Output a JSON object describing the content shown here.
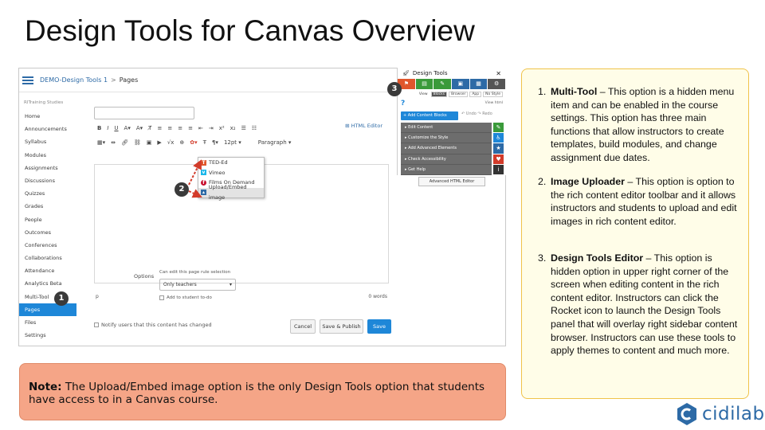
{
  "slide": {
    "title": "Design Tools for Canvas Overview"
  },
  "screenshot": {
    "breadcrumb": {
      "course": "DEMO-Design Tools 1",
      "separator": ">",
      "current": "Pages"
    },
    "course_label": "RITraining Studies",
    "nav_items": [
      "Home",
      "Announcements",
      "Syllabus",
      "Modules",
      "Assignments",
      "Discussions",
      "Quizzes",
      "Grades",
      "People",
      "Outcomes",
      "Conferences",
      "Collaborations",
      "Attendance",
      "Analytics Beta",
      "Multi-Tool",
      "Pages",
      "Files",
      "Settings"
    ],
    "active_nav": "Pages",
    "html_editor_link": "HTML Editor",
    "toolbar": {
      "font_size": "12pt",
      "paragraph": "Paragraph"
    },
    "dropdown_items": [
      "TED-Ed",
      "Vimeo",
      "Films On Demand",
      "Upload/Embed image"
    ],
    "path_label": "p",
    "word_count": "0 words",
    "options_label": "Options",
    "edit_permission_label": "Can edit this page rule selection",
    "edit_permission_value": "Only teachers",
    "add_to_todo": "Add to student to-do",
    "notify_label": "Notify users that this content has changed",
    "buttons": {
      "cancel": "Cancel",
      "save_publish": "Save & Publish",
      "save": "Save"
    },
    "badges": [
      "1",
      "2",
      "3"
    ]
  },
  "design_tools_panel": {
    "title": "Design Tools",
    "view_label": "View",
    "tabs": [
      "Blocks",
      "Browser",
      "App",
      "No Style"
    ],
    "active_tab": "Blocks",
    "view_right": "View html",
    "add_button": "+ Add Content Blocks",
    "undo": "Undo",
    "redo": "Redo",
    "menu": [
      "Edit Content",
      "Customize the Style",
      "Add Advanced Elements",
      "Check Accessibility",
      "Get Help"
    ],
    "adv_html": "Advanced HTML Editor",
    "colors": {
      "icon_bar": [
        "#e0562c",
        "#3a9a3a",
        "#3a9a3a",
        "#2d6aa6",
        "#2d6aa6",
        "#555555"
      ],
      "side": [
        "#3a9a3a",
        "#1e87d8",
        "#2d6aa6",
        "#d23b2a",
        "#333333"
      ]
    }
  },
  "note": {
    "label": "Note:",
    "text": "The Upload/Embed image option is the only Design Tools option that students have access to in a Canvas course."
  },
  "descriptions": [
    {
      "number": "1.",
      "term": "Multi-Tool",
      "text": " – This option is a hidden menu item and can be enabled in the course settings. This option has three main functions that allow instructors to create templates, build modules, and change assignment due dates."
    },
    {
      "number": "2.",
      "term": "Image Uploader",
      "text": " – This option is option to the rich content editor toolbar and it allows instructors and students to upload and edit images in rich content editor."
    },
    {
      "number": "3.",
      "term": "Design Tools Editor",
      "text": " – This option is hidden option in upper right corner of the screen when editing content in the rich content editor. Instructors can click the Rocket icon to launch the Design Tools panel that will overlay right sidebar content browser. Instructors can use these tools to apply themes to content and much more."
    }
  ],
  "logo": {
    "text": "cidilabs",
    "color": "#2d6aa6"
  }
}
